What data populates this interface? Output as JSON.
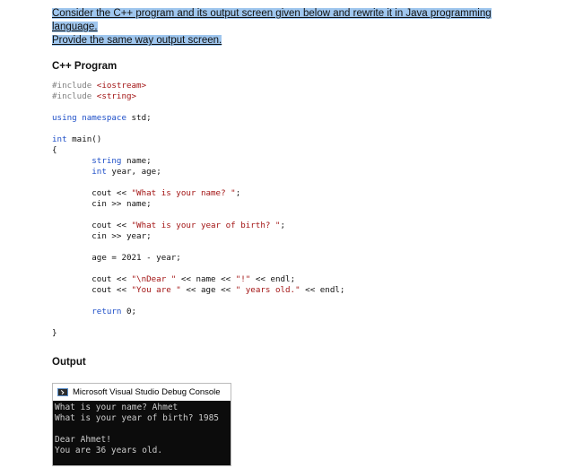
{
  "question": {
    "line1": "Consider the C++ program and its output screen given below and rewrite it in Java programming language.",
    "line2": "Provide the same way output screen."
  },
  "cpp_heading": "C++ Program",
  "code_lines": [
    [
      {
        "t": "#include ",
        "c": "pp"
      },
      {
        "t": "<iostream>",
        "c": "str"
      }
    ],
    [
      {
        "t": "#include ",
        "c": "pp"
      },
      {
        "t": "<string>",
        "c": "str"
      }
    ],
    [],
    [
      {
        "t": "using namespace",
        "c": "kw"
      },
      {
        "t": " std;",
        "c": ""
      }
    ],
    [],
    [
      {
        "t": "int",
        "c": "kw"
      },
      {
        "t": " main()",
        "c": ""
      }
    ],
    [
      {
        "t": "{",
        "c": ""
      }
    ],
    [
      {
        "t": "        ",
        "c": ""
      },
      {
        "t": "string",
        "c": "kw"
      },
      {
        "t": " name;",
        "c": ""
      }
    ],
    [
      {
        "t": "        ",
        "c": ""
      },
      {
        "t": "int",
        "c": "kw"
      },
      {
        "t": " year, age;",
        "c": ""
      }
    ],
    [],
    [
      {
        "t": "        cout << ",
        "c": ""
      },
      {
        "t": "\"What is your name? \"",
        "c": "str"
      },
      {
        "t": ";",
        "c": ""
      }
    ],
    [
      {
        "t": "        cin >> name;",
        "c": ""
      }
    ],
    [],
    [
      {
        "t": "        cout << ",
        "c": ""
      },
      {
        "t": "\"What is your year of birth? \"",
        "c": "str"
      },
      {
        "t": ";",
        "c": ""
      }
    ],
    [
      {
        "t": "        cin >> year;",
        "c": ""
      }
    ],
    [],
    [
      {
        "t": "        age = 2021 - year;",
        "c": ""
      }
    ],
    [],
    [
      {
        "t": "        cout << ",
        "c": ""
      },
      {
        "t": "\"\\nDear \"",
        "c": "str"
      },
      {
        "t": " << name << ",
        "c": ""
      },
      {
        "t": "\"!\"",
        "c": "str"
      },
      {
        "t": " << endl;",
        "c": ""
      }
    ],
    [
      {
        "t": "        cout << ",
        "c": ""
      },
      {
        "t": "\"You are \"",
        "c": "str"
      },
      {
        "t": " << age << ",
        "c": ""
      },
      {
        "t": "\" years old.\"",
        "c": "str"
      },
      {
        "t": " << endl;",
        "c": ""
      }
    ],
    [],
    [
      {
        "t": "        ",
        "c": ""
      },
      {
        "t": "return",
        "c": "kw"
      },
      {
        "t": " 0;",
        "c": ""
      }
    ],
    [],
    [
      {
        "t": "}",
        "c": ""
      }
    ]
  ],
  "output_heading": "Output",
  "console": {
    "title": "Microsoft Visual Studio Debug Console",
    "icon": "console-window-icon",
    "lines": [
      "What is your name? Ahmet",
      "What is your year of birth? 1985",
      "",
      "Dear Ahmet!",
      "You are 36 years old."
    ]
  }
}
